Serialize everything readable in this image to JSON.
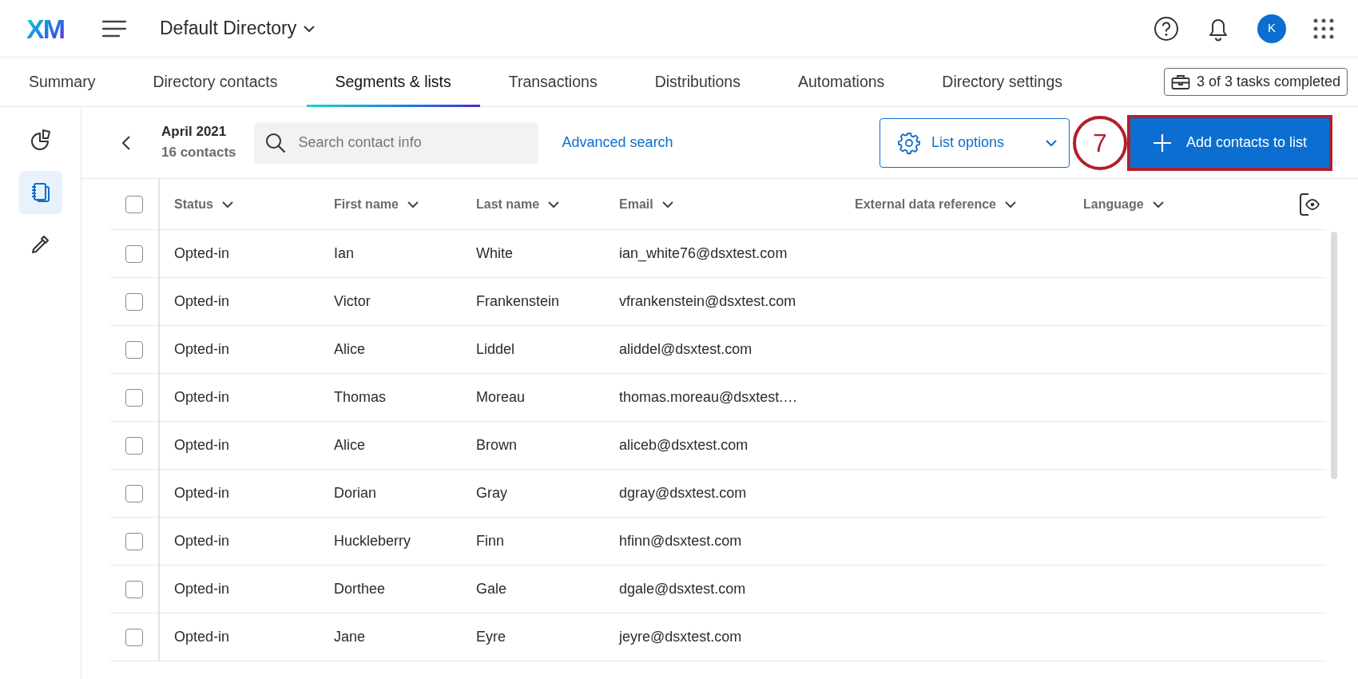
{
  "header": {
    "logo": "XM",
    "directory": "Default Directory",
    "avatar": "K"
  },
  "tabs": [
    {
      "label": "Summary",
      "selected": false
    },
    {
      "label": "Directory contacts",
      "selected": false
    },
    {
      "label": "Segments & lists",
      "selected": true
    },
    {
      "label": "Transactions",
      "selected": false
    },
    {
      "label": "Distributions",
      "selected": false
    },
    {
      "label": "Automations",
      "selected": false
    },
    {
      "label": "Directory settings",
      "selected": false
    }
  ],
  "tasks_button": "3 of 3 tasks completed",
  "sidebar": {
    "items": [
      {
        "kind": "chart",
        "selected": false
      },
      {
        "kind": "lists",
        "selected": true
      },
      {
        "kind": "dropper",
        "selected": false
      }
    ]
  },
  "list": {
    "title": "April 2021",
    "count": "16 contacts"
  },
  "search": {
    "placeholder": "Search contact info"
  },
  "advanced_search": "Advanced search",
  "list_options": "List options",
  "add_button": "Add contacts to list",
  "callout": {
    "number": "7"
  },
  "table": {
    "select_all_checked": false,
    "columns": [
      "Status",
      "First name",
      "Last name",
      "Email",
      "External data reference",
      "Language"
    ],
    "rows": [
      {
        "checked": false,
        "cells": [
          "Opted-in",
          "Ian",
          "White",
          "ian_white76@dsxtest.com"
        ]
      },
      {
        "checked": false,
        "cells": [
          "Opted-in",
          "Victor",
          "Frankenstein",
          "vfrankenstein@dsxtest.com"
        ]
      },
      {
        "checked": false,
        "cells": [
          "Opted-in",
          "Alice",
          "Liddel",
          "aliddel@dsxtest.com"
        ]
      },
      {
        "checked": false,
        "cells": [
          "Opted-in",
          "Thomas",
          "Moreau",
          "thomas.moreau@dsxtest.…"
        ]
      },
      {
        "checked": false,
        "cells": [
          "Opted-in",
          "Alice",
          "Brown",
          "aliceb@dsxtest.com"
        ]
      },
      {
        "checked": false,
        "cells": [
          "Opted-in",
          "Dorian",
          "Gray",
          "dgray@dsxtest.com"
        ]
      },
      {
        "checked": false,
        "cells": [
          "Opted-in",
          "Huckleberry",
          "Finn",
          "hfinn@dsxtest.com"
        ]
      },
      {
        "checked": false,
        "cells": [
          "Opted-in",
          "Dorthee",
          "Gale",
          "dgale@dsxtest.com"
        ]
      },
      {
        "checked": false,
        "cells": [
          "Opted-in",
          "Jane",
          "Eyre",
          "jeyre@dsxtest.com"
        ]
      }
    ]
  }
}
